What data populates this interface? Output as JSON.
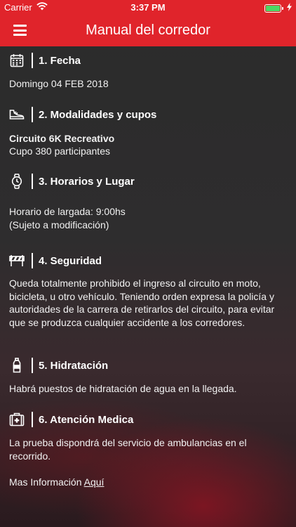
{
  "status_bar": {
    "carrier": "Carrier",
    "time": "3:37 PM"
  },
  "nav": {
    "title": "Manual del corredor"
  },
  "sections": [
    {
      "title": "1. Fecha",
      "icon": "calendar-icon",
      "lines": [
        "Domingo 04 FEB 2018"
      ]
    },
    {
      "title": "2. Modalidades y cupos",
      "icon": "shoe-icon",
      "bold_line": "Circuito 6K Recreativo",
      "lines": [
        "Cupo 380 participantes"
      ]
    },
    {
      "title": "3. Horarios y Lugar",
      "icon": "watch-icon",
      "lines": [
        "Horario de largada: 9:00hs",
        "(Sujeto a modificación)"
      ]
    },
    {
      "title": "4. Seguridad",
      "icon": "barrier-icon",
      "paragraph": "Queda totalmente prohibido el ingreso al circuito en moto, bicicleta, u otro vehículo. Teniendo orden expresa la policía y autoridades de la carrera de retirarlos del circuito, para evitar que se produzca cualquier accidente a los corredores."
    },
    {
      "title": "5. Hidratación",
      "icon": "water-bottle-icon",
      "paragraph": "Habrá puestos de hidratación de agua en la llegada."
    },
    {
      "title": "6. Atención Medica",
      "icon": "first-aid-kit-icon",
      "paragraph": "La prueba dispondrá del servicio de ambulancias en el recorrido.",
      "more_info_label": "Mas Información",
      "more_info_link": "Aquí"
    }
  ],
  "colors": {
    "accent": "#e0242b",
    "background": "#2b2b2b",
    "battery": "#4cd964"
  }
}
